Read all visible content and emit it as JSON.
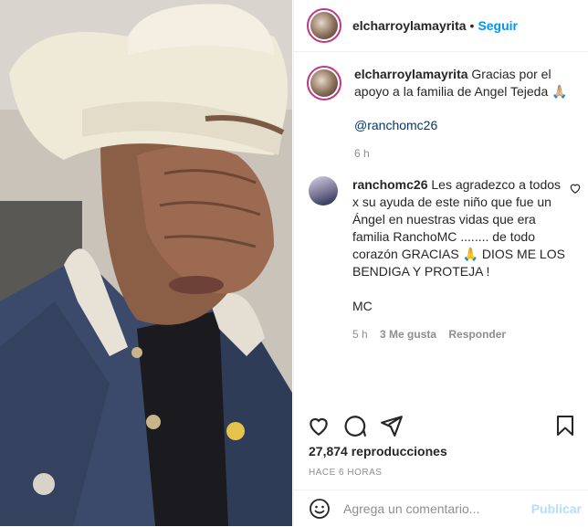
{
  "header": {
    "username": "elcharroylamayrita",
    "separator": "•",
    "follow_label": "Seguir"
  },
  "caption": {
    "username": "elcharroylamayrita",
    "text": "Gracias por el apoyo a la familia de Angel Tejeda 🙏🏼",
    "mention": "@ranchomc26",
    "time": "6 h"
  },
  "comment": {
    "username": "ranchomc26",
    "text": "Les agradezco a todos x su ayuda de este niño que fue un Ángel en nuestras vidas que era familia RanchoMC ........ de todo corazón GRACIAS 🙏 DIOS ME LOS BENDIGA Y PROTEJA !\n\nMC",
    "time": "5 h",
    "likes": "3 Me gusta",
    "reply_label": "Responder"
  },
  "stats": {
    "views": "27,874 reproducciones",
    "posted": "HACE 6 HORAS"
  },
  "add_comment": {
    "placeholder": "Agrega un comentario...",
    "publish_label": "Publicar"
  },
  "icons": [
    "emoji-icon",
    "heart-icon",
    "comment-icon",
    "share-icon",
    "bookmark-icon"
  ],
  "colors": {
    "link": "#0095f6",
    "muted": "#8e8e8e",
    "publish_disabled": "#b2dffc",
    "mention": "#00376b"
  }
}
